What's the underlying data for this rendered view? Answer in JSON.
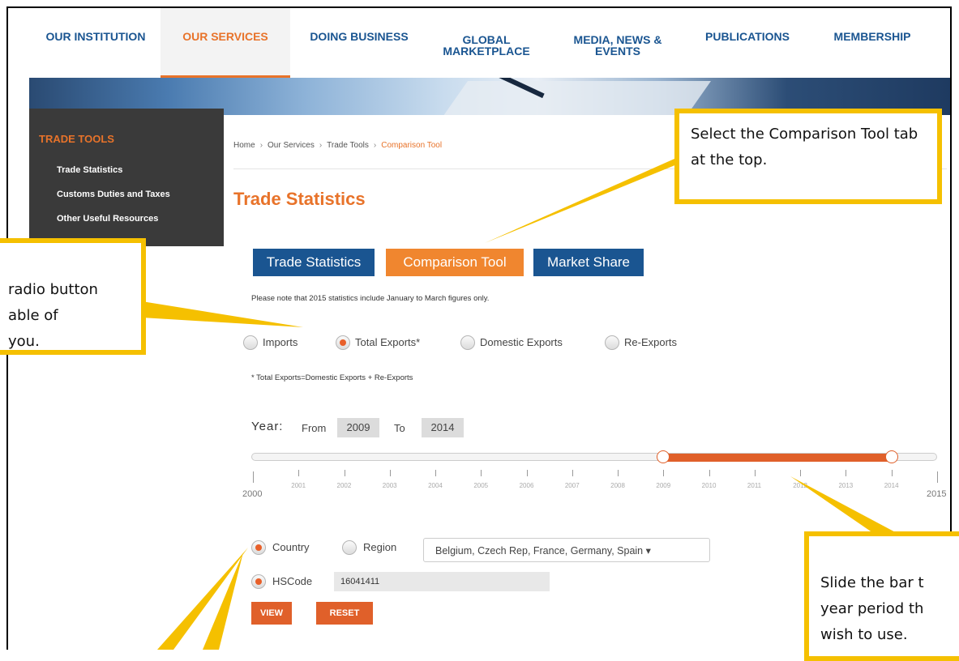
{
  "nav": {
    "items": [
      "OUR INSTITUTION",
      "OUR SERVICES",
      "DOING BUSINESS",
      "GLOBAL\nMARKETPLACE",
      "MEDIA, NEWS &\nEVENTS",
      "PUBLICATIONS",
      "MEMBERSHIP"
    ],
    "active": "OUR SERVICES"
  },
  "sidebar": {
    "title": "TRADE TOOLS",
    "items": [
      "Trade Statistics",
      "Customs Duties and Taxes",
      "Other Useful Resources"
    ]
  },
  "breadcrumb": [
    "Home",
    "Our Services",
    "Trade Tools",
    "Comparison Tool"
  ],
  "page_title": "Trade Statistics",
  "tabs": [
    {
      "label": "Trade Statistics",
      "active": false
    },
    {
      "label": "Comparison Tool",
      "active": true
    },
    {
      "label": "Market Share",
      "active": false
    }
  ],
  "note": "Please note that 2015 statistics include January to March figures only.",
  "trade_type": {
    "options": [
      "Imports",
      "Total Exports*",
      "Domestic Exports",
      "Re-Exports"
    ],
    "selected": "Total Exports*"
  },
  "footnote": "* Total Exports=Domestic Exports + Re-Exports",
  "year": {
    "label": "Year:",
    "from_label": "From",
    "to_label": "To",
    "from": "2009",
    "to": "2014",
    "range": [
      2000,
      2015
    ],
    "ticks": [
      "2000",
      "2001",
      "2002",
      "2003",
      "2004",
      "2005",
      "2006",
      "2007",
      "2008",
      "2009",
      "2010",
      "2011",
      "2012",
      "2013",
      "2014",
      "2015"
    ]
  },
  "scope": {
    "options": [
      "Country",
      "Region"
    ],
    "selected": "Country",
    "countries": "Belgium, Czech Rep, France, Germany, Spain"
  },
  "hscode": {
    "label": "HSCode",
    "value": "16041411"
  },
  "buttons": {
    "view": "VIEW",
    "reset": "RESET"
  },
  "callouts": {
    "tab": "Select the Comparison Tool tab at the top.",
    "radio": "radio button\nable of\nyou.",
    "slider": "Slide the bar t\nyear period th\nwish to use."
  },
  "colors": {
    "accent": "#e8732a",
    "nav_blue": "#1a5591",
    "callout": "#f5c000"
  }
}
